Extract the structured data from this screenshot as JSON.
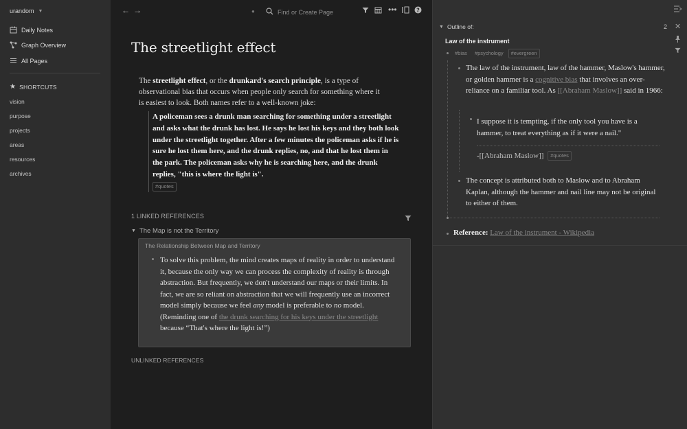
{
  "sidebar": {
    "graph_name": "urandom",
    "nav": [
      {
        "label": "Daily Notes",
        "icon": "calendar-icon"
      },
      {
        "label": "Graph Overview",
        "icon": "graph-icon"
      },
      {
        "label": "All Pages",
        "icon": "list-icon"
      }
    ],
    "shortcuts_label": "SHORTCUTS",
    "shortcuts": [
      "vision",
      "purpose",
      "projects",
      "areas",
      "resources",
      "archives"
    ]
  },
  "topbar": {
    "search_placeholder": "Find or Create Page"
  },
  "page": {
    "title": "The streetlight effect",
    "intro_1": "The ",
    "intro_bold_1": "streetlight effect",
    "intro_2": ", or the ",
    "intro_bold_2": "drunkard's search principle",
    "intro_3": ", is a type of observational bias that occurs when people only search for something where it is easiest to look. Both names refer to a well-known joke:",
    "quote": "A policeman sees a drunk man searching for something under a streetlight and asks what the drunk has lost. He says he lost his keys and they both look under the streetlight together. After a few minutes the policeman asks if he is sure he lost them here, and the drunk replies, no, and that he lost them in the park. The policeman asks why he is searching here, and the drunk replies, \"this is where the light is\".",
    "quote_tag": "#quotes"
  },
  "linked_refs": {
    "header": "1 LINKED REFERENCES",
    "page": "The Map is not the Territory",
    "breadcrumb": "The Relationship Between Map and Territory",
    "text_1": "To solve this problem, the mind creates maps of reality in order to understand it, because the only way we can process the complexity of reality is through abstraction. But frequently, we don't understand our maps or their limits. In fact, we are so reliant on abstraction that we will frequently use an incorrect model simply because we feel ",
    "em_1": "any",
    "text_2": " model is preferable to ",
    "em_2": "no",
    "text_3": " model. (Reminding one of ",
    "link": "the drunk searching for his keys under the streetlight",
    "text_4": " because “That's where the light is!”)"
  },
  "unlinked_refs": {
    "header": "UNLINKED REFERENCES"
  },
  "right_panel": {
    "outline_label": "Outline of:",
    "count": "2",
    "title": "Law of the instrument",
    "tags": [
      "#bias",
      "#psychology",
      "#evergreen"
    ],
    "block1_a": "The law of the instrument, law of the hammer, Maslow's hammer, or golden hammer is a ",
    "block1_link": "cognitive bias",
    "block1_b": " that involves an over-reliance on a familiar tool. As ",
    "block1_ref": "[[Abraham Maslow]]",
    "block1_c": " said in 1966:",
    "quote": "I suppose it is tempting, if the only tool you have is a hammer, to treat everything as if it were a nail.\"",
    "quote_attr_dash": "-",
    "quote_attr": "[[Abraham Maslow]]",
    "quote_tag": "#quotes",
    "block2": "The concept is attributed both to Maslow and to Abraham Kaplan, although the hammer and nail line may not be original to either of them.",
    "reference_label": "Reference:",
    "reference_link": "Law of the instrument - Wikipedia"
  }
}
